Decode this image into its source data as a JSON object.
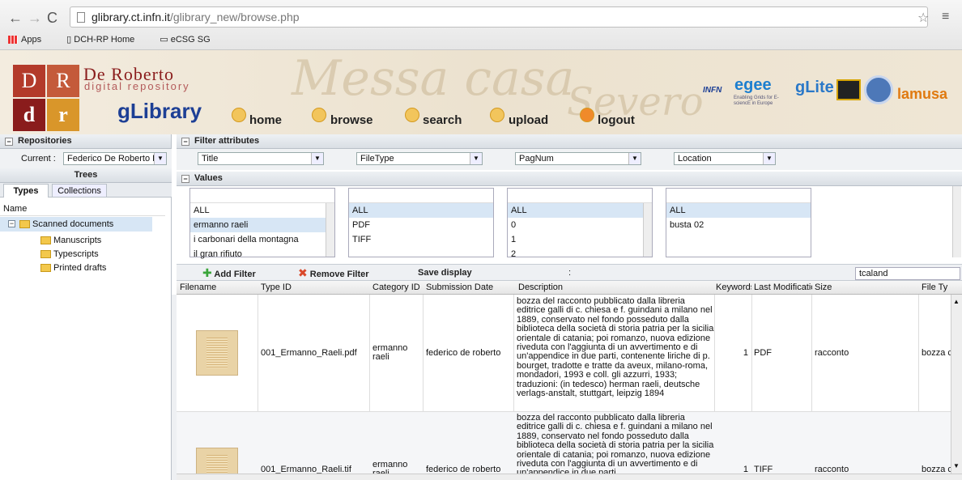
{
  "browser": {
    "url_host": "glibrary.ct.infn.it",
    "url_path": "/glibrary_new/browse.php",
    "bookmarks": [
      "Apps",
      "DCH-RP Home",
      "eCSG SG"
    ]
  },
  "header": {
    "logo_letters": [
      "D",
      "R",
      "d",
      "r"
    ],
    "logo_title": "De Roberto",
    "logo_subtitle": "digital repository",
    "glibrary": "gLibrary",
    "nav": [
      "home",
      "browse",
      "search",
      "upload",
      "logout"
    ],
    "partners": [
      "INFN",
      "egee",
      "gLite",
      "lamusa"
    ],
    "partner_tagline": "Enabling Grids for E-sciencE in Europe"
  },
  "sidebar": {
    "repositories_title": "Repositories",
    "current_label": "Current :",
    "current_value": "Federico De Roberto D",
    "trees_title": "Trees",
    "tabs": [
      "Types",
      "Collections"
    ],
    "tree_header": "Name",
    "tree_root": "Scanned documents",
    "tree_children": [
      "Manuscripts",
      "Typescripts",
      "Printed drafts"
    ]
  },
  "filters": {
    "title": "Filter attributes",
    "selects": [
      "Title",
      "FileType",
      "PagNum",
      "Location"
    ]
  },
  "values": {
    "title": "Values",
    "lists": [
      [
        "ALL",
        "ermanno raeli",
        "i carbonari della montagna",
        "il gran rifiuto"
      ],
      [
        "ALL",
        "PDF",
        "TIFF"
      ],
      [
        "ALL",
        "0",
        "1",
        "2"
      ],
      [
        "ALL",
        "busta 02"
      ]
    ]
  },
  "toolbar": {
    "add_filter": "Add Filter",
    "remove_filter": "Remove Filter",
    "save_display": "Save display",
    "separator": ":",
    "search_value": "tcaland"
  },
  "grid": {
    "columns": [
      "Filename",
      "Type ID",
      "Category ID",
      "Submission Date",
      "Description",
      "Keywords",
      "Last Modification",
      "Size",
      "File Ty"
    ],
    "rows": [
      {
        "filename": "001_Ermanno_Raeli.pdf",
        "type_id": "ermanno raeli",
        "category": "federico de roberto",
        "description": "bozza del racconto pubblicato dalla libreria editrice galli di c. chiesa e f. guindani a milano nel 1889, conservato nel fondo posseduto dalla biblioteca della società di storia patria per la sicilia orientale di catania; poi romanzo, nuova edizione riveduta con l'aggiunta di un avvertimento e di un'appendice in due parti, contenente liriche di p. bourget, tradotte e tratte da aveux, milano-roma, mondadori, 1993 e coll. gli azzurri, 1933; traduzioni: (in tedesco) herman raeli, deutsche verlags-anstalt, stuttgart, leipzig 1894",
        "keywords": "1",
        "last_mod": "PDF",
        "size": "racconto",
        "file_type": "bozza c"
      },
      {
        "filename": "001_Ermanno_Raeli.tif",
        "type_id": "ermanno raeli",
        "category": "federico de roberto",
        "description": "bozza del racconto pubblicato dalla libreria editrice galli di c. chiesa e f. guindani a milano nel 1889, conservato nel fondo posseduto dalla biblioteca della società di storia patria per la sicilia orientale di catania; poi romanzo, nuova edizione riveduta con l'aggiunta di un avvertimento e di un'appendice in due parti",
        "keywords": "1",
        "last_mod": "TIFF",
        "size": "racconto",
        "file_type": "bozza c"
      }
    ]
  },
  "colors": {
    "accent": "#1d3f95",
    "brand_red": "#8a1c1c",
    "selection": "#d7e6f5"
  }
}
